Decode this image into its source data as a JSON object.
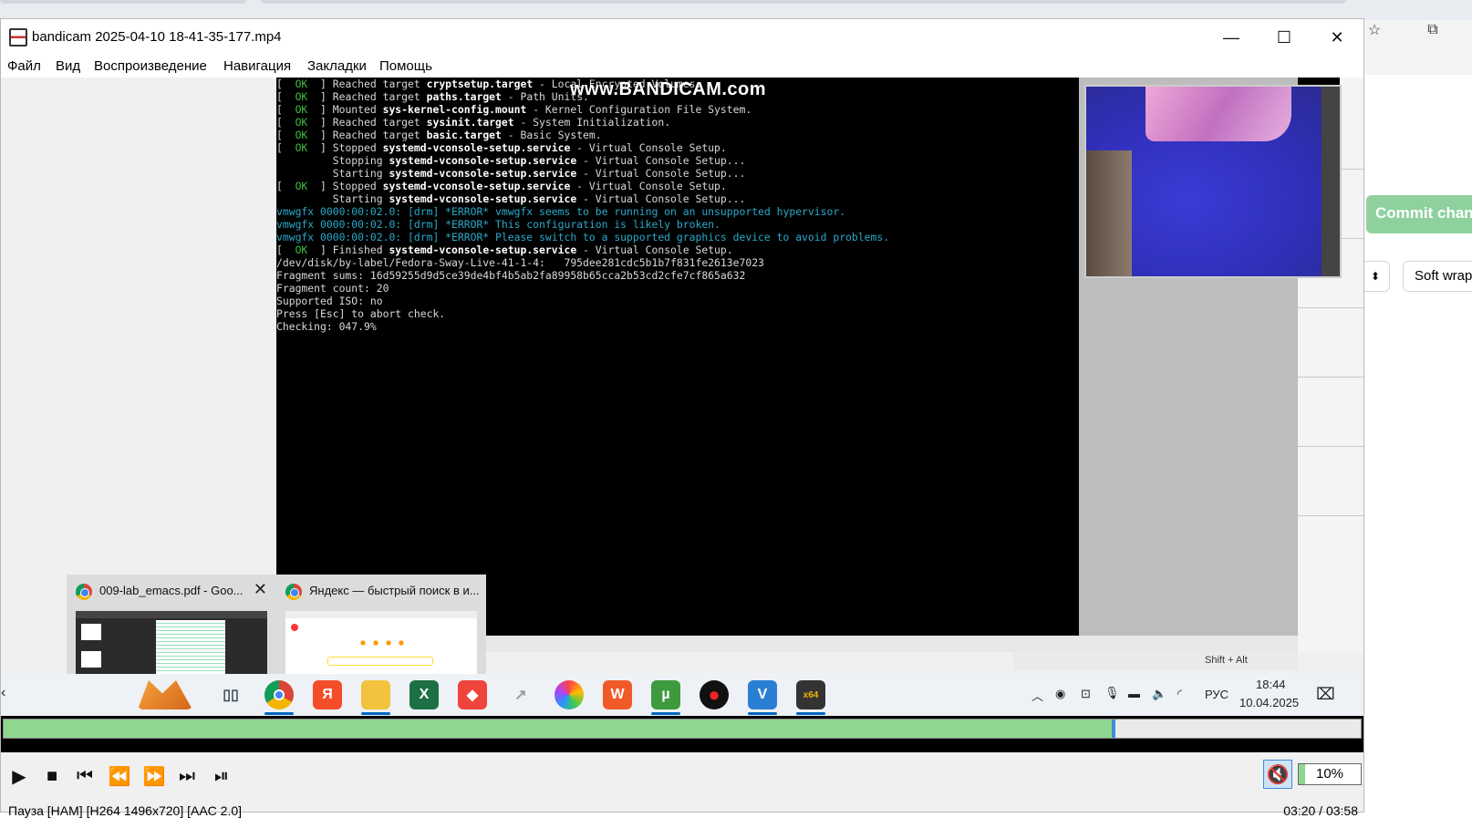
{
  "window": {
    "title": "bandicam 2025-04-10 18-41-35-177.mp4",
    "controls": [
      "minimize",
      "maximize",
      "close"
    ]
  },
  "menu": [
    "Файл",
    "Вид",
    "Воспроизведение",
    "Навигация",
    "Закладки",
    "Помощь"
  ],
  "terminal": {
    "watermark": "www.BANDICAM.com",
    "lines": [
      {
        "kind": "ok",
        "pre": "Reached target ",
        "b": "cryptsetup.target",
        "post": " - Local Encrypted Volumes."
      },
      {
        "kind": "ok",
        "pre": "Reached target ",
        "b": "paths.target",
        "post": " - Path Units."
      },
      {
        "kind": "ok",
        "pre": "Mounted ",
        "b": "sys-kernel-config.mount",
        "post": " - Kernel Configuration File System."
      },
      {
        "kind": "ok",
        "pre": "Reached target ",
        "b": "sysinit.target",
        "post": " - System Initialization."
      },
      {
        "kind": "ok",
        "pre": "Reached target ",
        "b": "basic.target",
        "post": " - Basic System."
      },
      {
        "kind": "ok",
        "pre": "Stopped ",
        "b": "systemd-vconsole-setup.service",
        "post": " - Virtual Console Setup."
      },
      {
        "kind": "plain",
        "pre": "         Stopping ",
        "b": "systemd-vconsole-setup.service",
        "post": " - Virtual Console Setup..."
      },
      {
        "kind": "plain",
        "pre": "         Starting ",
        "b": "systemd-vconsole-setup.service",
        "post": " - Virtual Console Setup..."
      },
      {
        "kind": "ok",
        "pre": "Stopped ",
        "b": "systemd-vconsole-setup.service",
        "post": " - Virtual Console Setup."
      },
      {
        "kind": "plain",
        "pre": "         Starting ",
        "b": "systemd-vconsole-setup.service",
        "post": " - Virtual Console Setup..."
      },
      {
        "kind": "err",
        "text": "vmwgfx 0000:00:02.0: [drm] *ERROR* vmwgfx seems to be running on an unsupported hypervisor."
      },
      {
        "kind": "err",
        "text": "vmwgfx 0000:00:02.0: [drm] *ERROR* This configuration is likely broken."
      },
      {
        "kind": "err",
        "text": "vmwgfx 0000:00:02.0: [drm] *ERROR* Please switch to a supported graphics device to avoid problems."
      },
      {
        "kind": "ok",
        "pre": "Finished ",
        "b": "systemd-vconsole-setup.service",
        "post": " - Virtual Console Setup."
      },
      {
        "kind": "text",
        "text": "/dev/disk/by-label/Fedora-Sway-Live-41-1-4:   795dee281cdc5b1b7f831fe2613e7023"
      },
      {
        "kind": "text",
        "text": "Fragment sums: 16d59255d9d5ce39de4bf4b5ab2fa89958b65cca2b53cd2cfe7cf865a632"
      },
      {
        "kind": "text",
        "text": "Fragment count: 20"
      },
      {
        "kind": "text",
        "text": "Supported ISO: no"
      },
      {
        "kind": "text",
        "text": "Press [Esc] to abort check."
      },
      {
        "kind": "text",
        "text": "Checking: 047.9%"
      }
    ],
    "ok_label": "OK"
  },
  "vm_status": "Shift + Alt",
  "previews": [
    {
      "title": "009-lab_emacs.pdf - Goo...",
      "close": "✕"
    },
    {
      "title": "Яндекс — быстрый поиск в и..."
    }
  ],
  "taskbar": {
    "items": [
      {
        "name": "fox",
        "label": "",
        "color": "#e8892c"
      },
      {
        "name": "task-view",
        "label": "▯▯",
        "color": "#3c4a5c"
      },
      {
        "name": "chrome",
        "label": "",
        "color": "#ffffff"
      },
      {
        "name": "yandex",
        "label": "Я",
        "color": "#f44d2a"
      },
      {
        "name": "explorer",
        "label": "",
        "color": "#f3c23e"
      },
      {
        "name": "excel",
        "label": "X",
        "color": "#1d7044"
      },
      {
        "name": "anydesk",
        "label": "◆",
        "color": "#ef443b"
      },
      {
        "name": "app-grey",
        "label": "↗",
        "color": "#9a9a9a"
      },
      {
        "name": "browser-rainbow",
        "label": "",
        "color": "#8a5cf6"
      },
      {
        "name": "wps",
        "label": "W",
        "color": "#f05a28"
      },
      {
        "name": "utorrent",
        "label": "µ",
        "color": "#3d9a3d"
      },
      {
        "name": "bandicam",
        "label": "●",
        "color": "#111111"
      },
      {
        "name": "vscode-like",
        "label": "V",
        "color": "#2a7fd4"
      },
      {
        "name": "x64dbg",
        "label": "x64",
        "color": "#333333"
      }
    ],
    "lang": "РУС",
    "time": "18:44",
    "date": "10.04.2025"
  },
  "player": {
    "progress": 0.8165,
    "volume_label": "10%",
    "volume_level": 0.1,
    "status_left": "Пауза [HAM]     [H264 1496x720]     [AAC 2.0]",
    "status_right": "03:20 / 03:58"
  },
  "background_browser": {
    "commit_label": "Commit chan",
    "softwrap_label": "Soft wrap"
  },
  "colors": {
    "seek_fill": "#8fd68f",
    "seek_knob": "#3c8dde",
    "commit_green": "#8fd19e"
  }
}
